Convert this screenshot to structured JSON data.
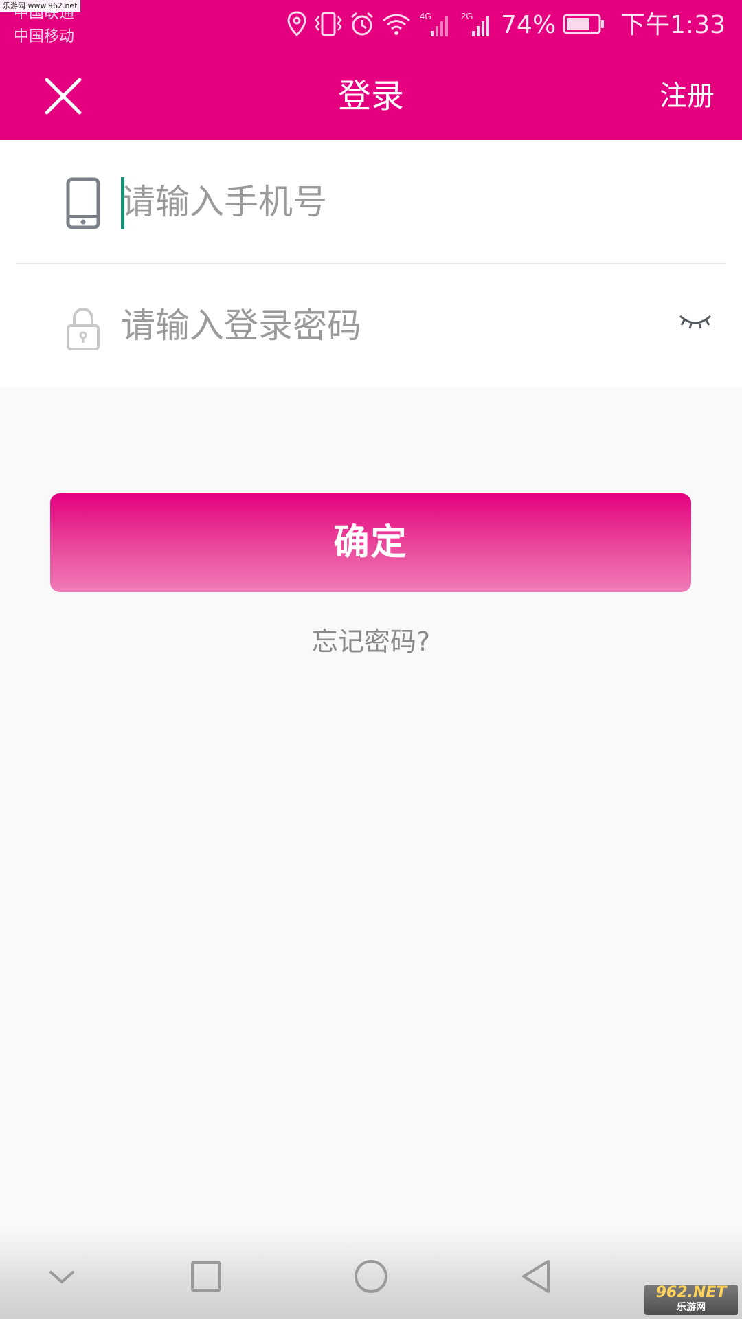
{
  "status_bar": {
    "watermark": "乐游网 www.962.net",
    "carrier_1": "中国联通",
    "carrier_2": "中国移动",
    "net_1": "4G",
    "net_2": "2G",
    "battery_percent": "74%",
    "battery_level": 0.74,
    "time": "下午1:33"
  },
  "header": {
    "title": "登录",
    "register_label": "注册",
    "background_color": "#e4007f"
  },
  "form": {
    "phone_placeholder": "请输入手机号",
    "phone_value": "",
    "password_placeholder": "请输入登录密码",
    "password_value": "",
    "cursor_color": "#1a9077"
  },
  "actions": {
    "confirm_label": "确定",
    "forgot_label": "忘记密码?"
  },
  "watermark_bottom": {
    "main": "962.NET",
    "sub": "乐游网"
  },
  "icons": {
    "close": "close-icon",
    "phone": "phone-icon",
    "lock": "lock-icon",
    "eye_closed": "eye-closed-icon",
    "location": "location-icon",
    "vibrate": "vibrate-icon",
    "alarm": "alarm-icon",
    "wifi": "wifi-icon",
    "signal": "signal-icon",
    "battery": "battery-icon",
    "nav_down": "chevron-down-icon",
    "nav_recent": "square-icon",
    "nav_home": "circle-icon",
    "nav_back": "triangle-back-icon"
  }
}
